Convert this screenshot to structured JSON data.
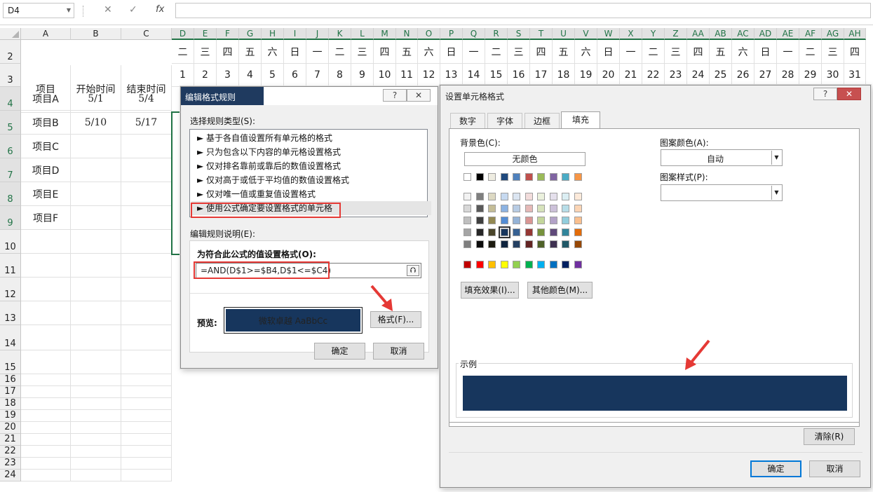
{
  "formula_bar": {
    "name_box": "D4",
    "cancel_icon": "✕",
    "enter_icon": "✓",
    "fx_label": "fx",
    "formula": ""
  },
  "sheet": {
    "fixed_columns": [
      "A",
      "B",
      "C"
    ],
    "date_columns": [
      "D",
      "E",
      "F",
      "G",
      "H",
      "I",
      "J",
      "K",
      "L",
      "M",
      "N",
      "O",
      "P",
      "Q",
      "R",
      "S",
      "T",
      "U",
      "V",
      "W",
      "X",
      "Y",
      "Z",
      "AA",
      "AB",
      "AC",
      "AD",
      "AE",
      "AF",
      "AG",
      "AH"
    ],
    "weekdays": [
      "二",
      "三",
      "四",
      "五",
      "六",
      "日",
      "一",
      "二",
      "三",
      "四",
      "五",
      "六",
      "日",
      "一",
      "二",
      "三",
      "四",
      "五",
      "六",
      "日",
      "一",
      "二",
      "三",
      "四",
      "五",
      "六",
      "日",
      "一",
      "二",
      "三",
      "四"
    ],
    "days": [
      "1",
      "2",
      "3",
      "4",
      "5",
      "6",
      "7",
      "8",
      "9",
      "10",
      "11",
      "12",
      "13",
      "14",
      "15",
      "16",
      "17",
      "18",
      "19",
      "20",
      "21",
      "22",
      "23",
      "24",
      "25",
      "26",
      "27",
      "28",
      "29",
      "30",
      "31"
    ],
    "headers": {
      "item": "项目",
      "start": "开始时间",
      "end": "结束时间"
    },
    "rows": [
      {
        "num": "4",
        "item": "项目A",
        "start": "5/1",
        "end": "5/4"
      },
      {
        "num": "5",
        "item": "项目B",
        "start": "5/10",
        "end": "5/17"
      },
      {
        "num": "6",
        "item": "项目C",
        "start": "",
        "end": ""
      },
      {
        "num": "7",
        "item": "项目D",
        "start": "",
        "end": ""
      },
      {
        "num": "8",
        "item": "项目E",
        "start": "",
        "end": ""
      },
      {
        "num": "9",
        "item": "项目F",
        "start": "",
        "end": ""
      }
    ],
    "row_numbers": [
      "2",
      "3",
      "4",
      "5",
      "6",
      "7",
      "8",
      "9",
      "10",
      "11",
      "12",
      "13",
      "14",
      "15",
      "16",
      "17",
      "18",
      "19",
      "20",
      "21",
      "22",
      "23",
      "24"
    ]
  },
  "edit_rule_dialog": {
    "title": "编辑格式规则",
    "help": "?",
    "close": "✕",
    "rule_type_label": "选择规则类型(S):",
    "rule_types": [
      "► 基于各自值设置所有单元格的格式",
      "► 只为包含以下内容的单元格设置格式",
      "► 仅对排名靠前或靠后的数值设置格式",
      "► 仅对高于或低于平均值的数值设置格式",
      "► 仅对唯一值或重复值设置格式",
      "► 使用公式确定要设置格式的单元格"
    ],
    "description_label": "编辑规则说明(E):",
    "formula_label": "为符合此公式的值设置格式(O):",
    "formula": "=AND(D$1>=$B4,D$1<=$C4)",
    "preview_label": "预览:",
    "preview_text": "微软卓越  AaBbCc",
    "format_button": "格式(F)...",
    "ok": "确定",
    "cancel": "取消"
  },
  "format_cells_dialog": {
    "title": "设置单元格格式",
    "help": "?",
    "close": "✕",
    "tabs": [
      "数字",
      "字体",
      "边框",
      "填充"
    ],
    "active_tab": "填充",
    "background_color_label": "背景色(C):",
    "no_color": "无颜色",
    "pattern_color_label": "图案颜色(A):",
    "pattern_color_value": "自动",
    "pattern_style_label": "图案样式(P):",
    "pattern_style_value": "",
    "fill_effects_button": "填充效果(I)...",
    "more_colors_button": "其他颜色(M)...",
    "sample_label": "示例",
    "sample_color": "#17365d",
    "clear_button": "清除(R)",
    "ok": "确定",
    "cancel": "取消",
    "theme_top_row": [
      "#ffffff",
      "#000000",
      "#eeece1",
      "#1f497d",
      "#4f81bd",
      "#c0504d",
      "#9bbb59",
      "#8064a2",
      "#4bacc6",
      "#f79646"
    ],
    "theme_shades": [
      [
        "#f2f2f2",
        "#7f7f7f",
        "#ddd9c3",
        "#c6d9f0",
        "#dbe5f1",
        "#f2dcdb",
        "#ebf1dd",
        "#e5e0ec",
        "#dbeef3",
        "#fdeada"
      ],
      [
        "#d8d8d8",
        "#595959",
        "#c4bd97",
        "#8db3e2",
        "#b8cce4",
        "#e5b9b7",
        "#d7e3bc",
        "#ccc1d9",
        "#b7dde8",
        "#fbd5b5"
      ],
      [
        "#bfbfbf",
        "#3f3f3f",
        "#938953",
        "#548dd4",
        "#95b3d7",
        "#d99694",
        "#c3d69b",
        "#b2a2c7",
        "#92cddc",
        "#fac08f"
      ],
      [
        "#a5a5a5",
        "#262626",
        "#494429",
        "#17365d",
        "#366092",
        "#953734",
        "#76923c",
        "#5f497a",
        "#31859b",
        "#e36c09"
      ],
      [
        "#7f7f7f",
        "#0c0c0c",
        "#1d1b10",
        "#0f243e",
        "#244061",
        "#632423",
        "#4f6128",
        "#3f3151",
        "#205867",
        "#974806"
      ]
    ],
    "standard_colors": [
      "#c00000",
      "#ff0000",
      "#ffc000",
      "#ffff00",
      "#92d050",
      "#00b050",
      "#00b0f0",
      "#0070c0",
      "#002060",
      "#7030a0"
    ],
    "selected_swatch": "#17365d"
  }
}
